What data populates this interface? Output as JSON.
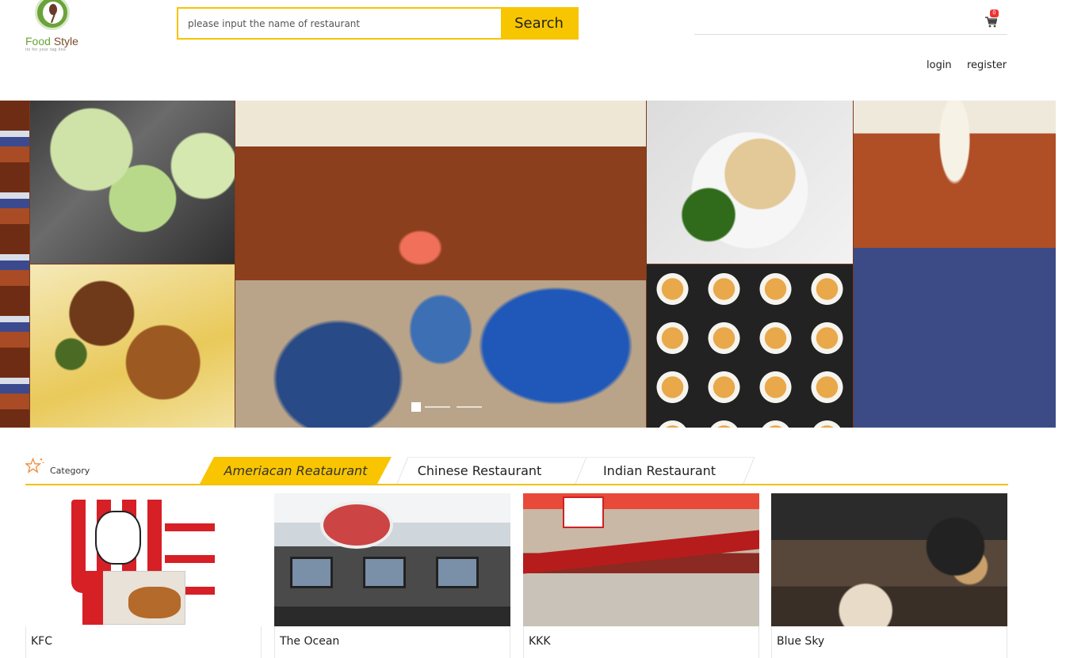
{
  "brand": {
    "name_part1": "Food",
    "name_part2": "Style",
    "tagline": "its for your tag line"
  },
  "search": {
    "placeholder": "please input the name of restaurant",
    "button_label": "Search"
  },
  "cart": {
    "icon": "shopping-cart-icon",
    "count": "0"
  },
  "auth": {
    "login": "login",
    "register": "register"
  },
  "banner": {
    "slide_count": 3,
    "active_slide": 1
  },
  "category": {
    "label": "Category",
    "icon": "star-icon",
    "tabs": [
      {
        "label": "Ameriacan Reataurant",
        "active": true
      },
      {
        "label": "Chinese Restaurant",
        "active": false
      },
      {
        "label": "Indian Restaurant",
        "active": false
      }
    ]
  },
  "restaurants": [
    {
      "name": "KFC"
    },
    {
      "name": "The Ocean"
    },
    {
      "name": "KKK"
    },
    {
      "name": "Blue Sky"
    }
  ],
  "colors": {
    "accent": "#f7c600",
    "brand_green": "#6aa33a",
    "badge_red": "#e33333"
  }
}
